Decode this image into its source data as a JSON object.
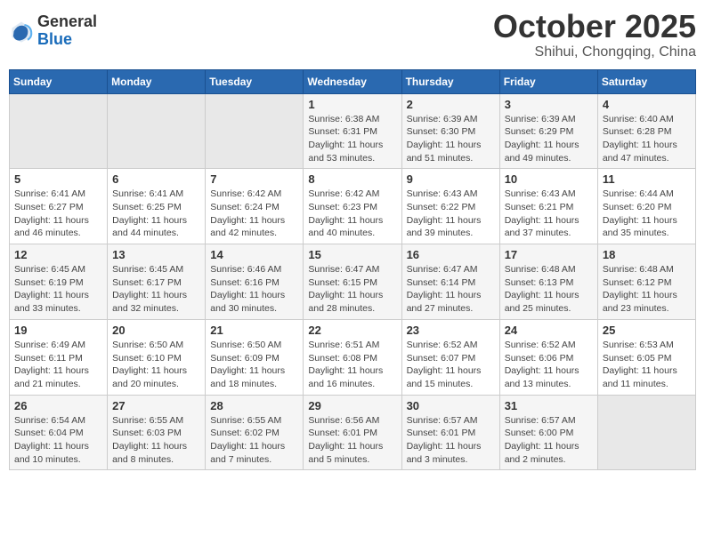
{
  "header": {
    "logo_general": "General",
    "logo_blue": "Blue",
    "month_title": "October 2025",
    "subtitle": "Shihui, Chongqing, China"
  },
  "weekdays": [
    "Sunday",
    "Monday",
    "Tuesday",
    "Wednesday",
    "Thursday",
    "Friday",
    "Saturday"
  ],
  "weeks": [
    [
      {
        "day": "",
        "detail": ""
      },
      {
        "day": "",
        "detail": ""
      },
      {
        "day": "",
        "detail": ""
      },
      {
        "day": "1",
        "detail": "Sunrise: 6:38 AM\nSunset: 6:31 PM\nDaylight: 11 hours and 53 minutes."
      },
      {
        "day": "2",
        "detail": "Sunrise: 6:39 AM\nSunset: 6:30 PM\nDaylight: 11 hours and 51 minutes."
      },
      {
        "day": "3",
        "detail": "Sunrise: 6:39 AM\nSunset: 6:29 PM\nDaylight: 11 hours and 49 minutes."
      },
      {
        "day": "4",
        "detail": "Sunrise: 6:40 AM\nSunset: 6:28 PM\nDaylight: 11 hours and 47 minutes."
      }
    ],
    [
      {
        "day": "5",
        "detail": "Sunrise: 6:41 AM\nSunset: 6:27 PM\nDaylight: 11 hours and 46 minutes."
      },
      {
        "day": "6",
        "detail": "Sunrise: 6:41 AM\nSunset: 6:25 PM\nDaylight: 11 hours and 44 minutes."
      },
      {
        "day": "7",
        "detail": "Sunrise: 6:42 AM\nSunset: 6:24 PM\nDaylight: 11 hours and 42 minutes."
      },
      {
        "day": "8",
        "detail": "Sunrise: 6:42 AM\nSunset: 6:23 PM\nDaylight: 11 hours and 40 minutes."
      },
      {
        "day": "9",
        "detail": "Sunrise: 6:43 AM\nSunset: 6:22 PM\nDaylight: 11 hours and 39 minutes."
      },
      {
        "day": "10",
        "detail": "Sunrise: 6:43 AM\nSunset: 6:21 PM\nDaylight: 11 hours and 37 minutes."
      },
      {
        "day": "11",
        "detail": "Sunrise: 6:44 AM\nSunset: 6:20 PM\nDaylight: 11 hours and 35 minutes."
      }
    ],
    [
      {
        "day": "12",
        "detail": "Sunrise: 6:45 AM\nSunset: 6:19 PM\nDaylight: 11 hours and 33 minutes."
      },
      {
        "day": "13",
        "detail": "Sunrise: 6:45 AM\nSunset: 6:17 PM\nDaylight: 11 hours and 32 minutes."
      },
      {
        "day": "14",
        "detail": "Sunrise: 6:46 AM\nSunset: 6:16 PM\nDaylight: 11 hours and 30 minutes."
      },
      {
        "day": "15",
        "detail": "Sunrise: 6:47 AM\nSunset: 6:15 PM\nDaylight: 11 hours and 28 minutes."
      },
      {
        "day": "16",
        "detail": "Sunrise: 6:47 AM\nSunset: 6:14 PM\nDaylight: 11 hours and 27 minutes."
      },
      {
        "day": "17",
        "detail": "Sunrise: 6:48 AM\nSunset: 6:13 PM\nDaylight: 11 hours and 25 minutes."
      },
      {
        "day": "18",
        "detail": "Sunrise: 6:48 AM\nSunset: 6:12 PM\nDaylight: 11 hours and 23 minutes."
      }
    ],
    [
      {
        "day": "19",
        "detail": "Sunrise: 6:49 AM\nSunset: 6:11 PM\nDaylight: 11 hours and 21 minutes."
      },
      {
        "day": "20",
        "detail": "Sunrise: 6:50 AM\nSunset: 6:10 PM\nDaylight: 11 hours and 20 minutes."
      },
      {
        "day": "21",
        "detail": "Sunrise: 6:50 AM\nSunset: 6:09 PM\nDaylight: 11 hours and 18 minutes."
      },
      {
        "day": "22",
        "detail": "Sunrise: 6:51 AM\nSunset: 6:08 PM\nDaylight: 11 hours and 16 minutes."
      },
      {
        "day": "23",
        "detail": "Sunrise: 6:52 AM\nSunset: 6:07 PM\nDaylight: 11 hours and 15 minutes."
      },
      {
        "day": "24",
        "detail": "Sunrise: 6:52 AM\nSunset: 6:06 PM\nDaylight: 11 hours and 13 minutes."
      },
      {
        "day": "25",
        "detail": "Sunrise: 6:53 AM\nSunset: 6:05 PM\nDaylight: 11 hours and 11 minutes."
      }
    ],
    [
      {
        "day": "26",
        "detail": "Sunrise: 6:54 AM\nSunset: 6:04 PM\nDaylight: 11 hours and 10 minutes."
      },
      {
        "day": "27",
        "detail": "Sunrise: 6:55 AM\nSunset: 6:03 PM\nDaylight: 11 hours and 8 minutes."
      },
      {
        "day": "28",
        "detail": "Sunrise: 6:55 AM\nSunset: 6:02 PM\nDaylight: 11 hours and 7 minutes."
      },
      {
        "day": "29",
        "detail": "Sunrise: 6:56 AM\nSunset: 6:01 PM\nDaylight: 11 hours and 5 minutes."
      },
      {
        "day": "30",
        "detail": "Sunrise: 6:57 AM\nSunset: 6:01 PM\nDaylight: 11 hours and 3 minutes."
      },
      {
        "day": "31",
        "detail": "Sunrise: 6:57 AM\nSunset: 6:00 PM\nDaylight: 11 hours and 2 minutes."
      },
      {
        "day": "",
        "detail": ""
      }
    ]
  ]
}
